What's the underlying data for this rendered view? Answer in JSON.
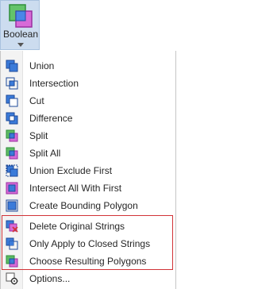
{
  "ribbon": {
    "button_label": "Boolean",
    "icon": "boolean-icon",
    "caret": "caret-down-icon"
  },
  "menu": {
    "items": [
      {
        "label": "Union",
        "icon": "union-icon"
      },
      {
        "label": "Intersection",
        "icon": "intersection-icon"
      },
      {
        "label": "Cut",
        "icon": "cut-icon"
      },
      {
        "label": "Difference",
        "icon": "difference-icon"
      },
      {
        "label": "Split",
        "icon": "split-icon"
      },
      {
        "label": "Split All",
        "icon": "split-all-icon"
      },
      {
        "label": "Union Exclude First",
        "icon": "union-exclude-first-icon"
      },
      {
        "label": "Intersect All With First",
        "icon": "intersect-all-with-first-icon"
      },
      {
        "label": "Create Bounding Polygon",
        "icon": "create-bounding-polygon-icon"
      },
      {
        "label": "Delete Original Strings",
        "icon": "delete-original-strings-icon"
      },
      {
        "label": "Only Apply to Closed Strings",
        "icon": "only-apply-closed-strings-icon"
      },
      {
        "label": "Choose Resulting Polygons",
        "icon": "choose-resulting-polygons-icon"
      },
      {
        "label": "Options...",
        "icon": "options-gear-icon"
      }
    ]
  },
  "colors": {
    "blue": "#2f6fd6",
    "green": "#4caf50",
    "magenta": "#d040d0",
    "ribbon_highlight": "#ccdcef",
    "group_border": "#d13438"
  }
}
